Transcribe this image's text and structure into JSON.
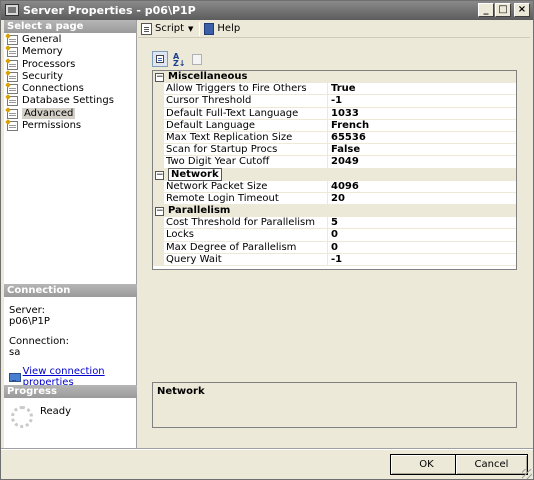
{
  "window": {
    "title": "Server Properties - p06\\P1P",
    "minimize_glyph": "_",
    "maximize_glyph": "□",
    "close_glyph": "×"
  },
  "left": {
    "select_page_title": "Select a page",
    "pages": [
      {
        "label": "General",
        "selected": false
      },
      {
        "label": "Memory",
        "selected": false
      },
      {
        "label": "Processors",
        "selected": false
      },
      {
        "label": "Security",
        "selected": false
      },
      {
        "label": "Connections",
        "selected": false
      },
      {
        "label": "Database Settings",
        "selected": false
      },
      {
        "label": "Advanced",
        "selected": true
      },
      {
        "label": "Permissions",
        "selected": false
      }
    ],
    "connection_title": "Connection",
    "server_label": "Server:",
    "server_value": "p06\\P1P",
    "connection_label": "Connection:",
    "connection_value": "sa",
    "view_link": "View connection properties",
    "progress_title": "Progress",
    "progress_status": "Ready"
  },
  "toolbar": {
    "script_label": "Script",
    "help_label": "Help"
  },
  "grid": {
    "sections": [
      {
        "name": "Miscellaneous",
        "selected": false,
        "props": [
          {
            "name": "Allow Triggers to Fire Others",
            "value": "True"
          },
          {
            "name": "Cursor Threshold",
            "value": "-1"
          },
          {
            "name": "Default Full-Text Language",
            "value": "1033"
          },
          {
            "name": "Default Language",
            "value": "French"
          },
          {
            "name": "Max Text Replication Size",
            "value": "65536"
          },
          {
            "name": "Scan for Startup Procs",
            "value": "False"
          },
          {
            "name": "Two Digit Year Cutoff",
            "value": "2049"
          }
        ]
      },
      {
        "name": "Network",
        "selected": true,
        "props": [
          {
            "name": "Network Packet Size",
            "value": "4096"
          },
          {
            "name": "Remote Login Timeout",
            "value": "20"
          }
        ]
      },
      {
        "name": "Parallelism",
        "selected": false,
        "props": [
          {
            "name": "Cost Threshold for Parallelism",
            "value": "5"
          },
          {
            "name": "Locks",
            "value": "0"
          },
          {
            "name": "Max Degree of Parallelism",
            "value": "0"
          },
          {
            "name": "Query Wait",
            "value": "-1"
          }
        ]
      }
    ],
    "collapse_glyph": "−"
  },
  "description": {
    "title": "Network"
  },
  "footer": {
    "ok_label": "OK",
    "cancel_label": "Cancel"
  }
}
